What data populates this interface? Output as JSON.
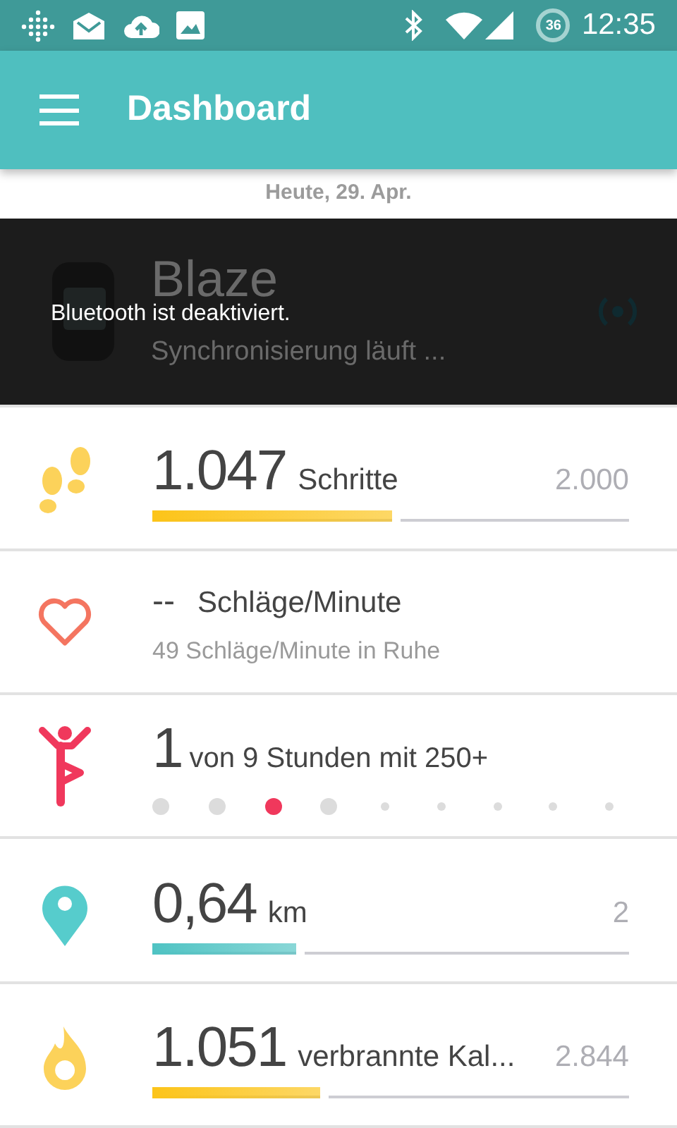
{
  "status_bar": {
    "time": "12:35",
    "battery": "36"
  },
  "app_bar": {
    "title": "Dashboard"
  },
  "date": "Heute, 29. Apr.",
  "device": {
    "name": "Blaze",
    "status": "Synchronisierung läuft ..."
  },
  "snackbar": {
    "message": "Bluetooth ist deaktiviert."
  },
  "stats": [
    {
      "kind": "steps",
      "value": "1.047",
      "unit": "Schritte",
      "goal": "2.000",
      "level": 0.52,
      "color": "#fcc419"
    },
    {
      "kind": "heart",
      "value": "--",
      "unit": "Schläge/Minute",
      "subtitle": "49 Schläge/Minute in Ruhe"
    },
    {
      "kind": "hourly",
      "value": "1",
      "unit": "von 9 Stunden mit 250+",
      "dots": [
        {
          "kind": "missed"
        },
        {
          "kind": "missed"
        },
        {
          "kind": "met"
        },
        {
          "kind": "missed"
        },
        {
          "kind": "upcoming"
        },
        {
          "kind": "upcoming"
        },
        {
          "kind": "upcoming"
        },
        {
          "kind": "upcoming"
        },
        {
          "kind": "upcoming"
        }
      ]
    },
    {
      "kind": "distance",
      "value": "0,64",
      "unit": "km",
      "goal": "2",
      "level": 0.32,
      "color": "#4fc3c3"
    },
    {
      "kind": "calories",
      "value": "1.051",
      "unit": "verbrannte Kal...",
      "goal": "2.844",
      "level": 0.37,
      "color": "#fcc419"
    }
  ]
}
